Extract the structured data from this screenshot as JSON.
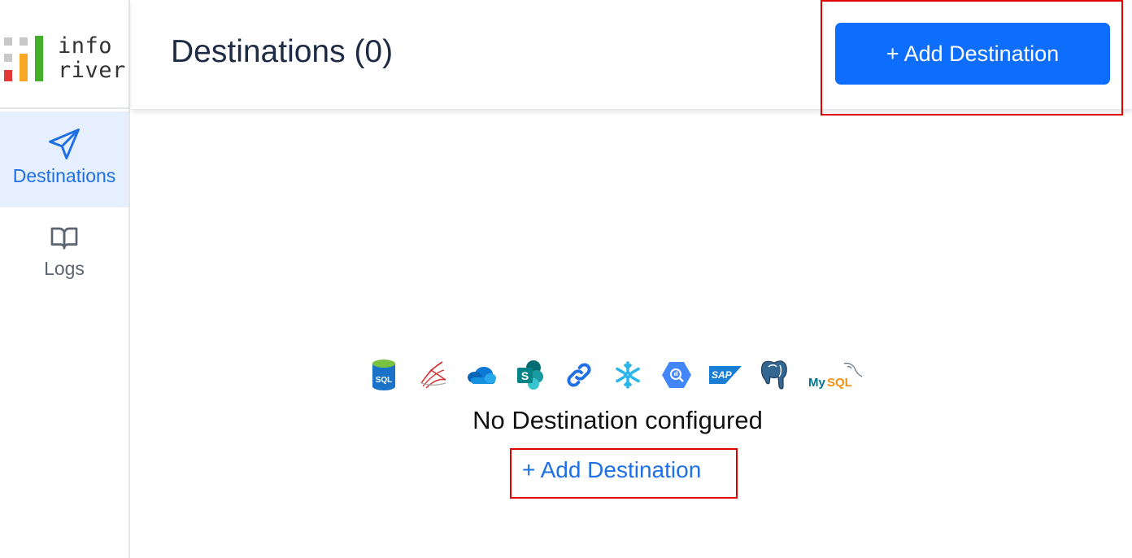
{
  "logo": {
    "line1": "info",
    "line2": "river"
  },
  "sidebar": {
    "items": [
      {
        "label": "Destinations",
        "icon": "send-icon",
        "active": true
      },
      {
        "label": "Logs",
        "icon": "book-icon",
        "active": false
      }
    ]
  },
  "header": {
    "title": "Destinations (0)",
    "add_button_label": "+ Add Destination"
  },
  "empty_state": {
    "message": "No Destination configured",
    "add_link_label": "+ Add Destination",
    "icons": [
      "sql-database-icon",
      "sql-server-icon",
      "onedrive-icon",
      "sharepoint-icon",
      "link-icon",
      "snowflake-icon",
      "bigquery-icon",
      "sap-icon",
      "postgresql-icon",
      "mysql-icon"
    ],
    "icon_texts": {
      "sql": "SQL",
      "sharepoint": "S",
      "sap": "SAP",
      "mysql_my": "My",
      "mysql_sql": "SQL"
    }
  },
  "colors": {
    "accent": "#0d6efd",
    "active_nav_bg": "#e5effd",
    "highlight_frame": "#e00000"
  }
}
